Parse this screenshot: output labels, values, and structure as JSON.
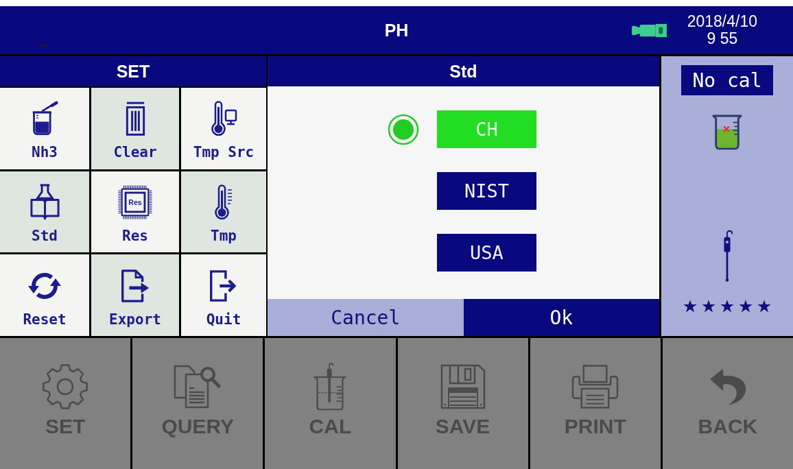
{
  "title_bar": {
    "title": "PH",
    "date": "2018/4/10",
    "time": "9 55"
  },
  "set_panel": {
    "title": "SET",
    "items": [
      {
        "label": "Nh3"
      },
      {
        "label": "Clear"
      },
      {
        "label": "Tmp Src"
      },
      {
        "label": "Std"
      },
      {
        "label": "Res"
      },
      {
        "label": "Tmp"
      },
      {
        "label": "Reset"
      },
      {
        "label": "Export"
      },
      {
        "label": "Quit"
      }
    ],
    "chip_icon_text": "Res"
  },
  "std_dialog": {
    "title": "Std",
    "options": [
      {
        "label": "CH",
        "selected": true
      },
      {
        "label": "NIST",
        "selected": false
      },
      {
        "label": "USA",
        "selected": false
      }
    ],
    "buttons": [
      {
        "label": "Cancel",
        "kind": "secondary"
      },
      {
        "label": "Ok",
        "kind": "primary"
      }
    ]
  },
  "calibration_panel": {
    "status": "No cal",
    "stars": 5
  },
  "toolbar": [
    {
      "label": "SET",
      "disabled": true
    },
    {
      "label": "QUERY",
      "disabled": true
    },
    {
      "label": "CAL",
      "disabled": true
    },
    {
      "label": "SAVE",
      "disabled": true
    },
    {
      "label": "PRINT",
      "disabled": true
    },
    {
      "label": "BACK",
      "disabled": true
    }
  ]
}
